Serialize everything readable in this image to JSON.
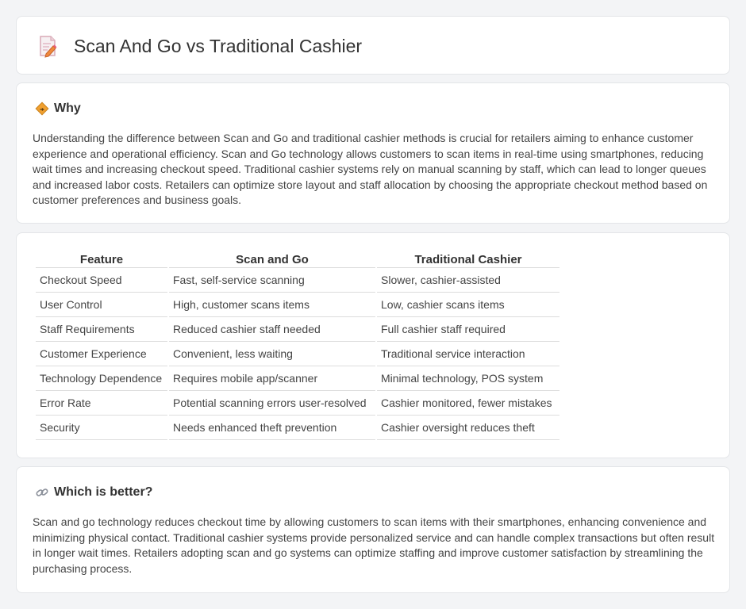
{
  "header": {
    "title": "Scan And Go vs Traditional Cashier",
    "icon": "document-edit-icon"
  },
  "why": {
    "heading": "Why",
    "icon": "diamond-sign-icon",
    "text": "Understanding the difference between Scan and Go and traditional cashier methods is crucial for retailers aiming to enhance customer experience and operational efficiency. Scan and Go technology allows customers to scan items in real-time using smartphones, reducing wait times and increasing checkout speed. Traditional cashier systems rely on manual scanning by staff, which can lead to longer queues and increased labor costs. Retailers can optimize store layout and staff allocation by choosing the appropriate checkout method based on customer preferences and business goals."
  },
  "table": {
    "headers": [
      "Feature",
      "Scan and Go",
      "Traditional Cashier"
    ],
    "rows": [
      [
        "Checkout Speed",
        "Fast, self-service scanning",
        "Slower, cashier-assisted"
      ],
      [
        "User Control",
        "High, customer scans items",
        "Low, cashier scans items"
      ],
      [
        "Staff Requirements",
        "Reduced cashier staff needed",
        "Full cashier staff required"
      ],
      [
        "Customer Experience",
        "Convenient, less waiting",
        "Traditional service interaction"
      ],
      [
        "Technology Dependence",
        "Requires mobile app/scanner",
        "Minimal technology, POS system"
      ],
      [
        "Error Rate",
        "Potential scanning errors user-resolved",
        "Cashier monitored, fewer mistakes"
      ],
      [
        "Security",
        "Needs enhanced theft prevention",
        "Cashier oversight reduces theft"
      ]
    ]
  },
  "better": {
    "heading": "Which is better?",
    "icon": "link-icon",
    "text": "Scan and go technology reduces checkout time by allowing customers to scan items with their smartphones, enhancing convenience and minimizing physical contact. Traditional cashier systems provide personalized service and can handle complex transactions but often result in longer wait times. Retailers adopting scan and go systems can optimize staffing and improve customer satisfaction by streamlining the purchasing process."
  },
  "colors": {
    "background": "#f3f4f6",
    "card": "#ffffff",
    "border": "#e3e5e8",
    "text": "#444444",
    "icon_accent": "#f0a030"
  }
}
